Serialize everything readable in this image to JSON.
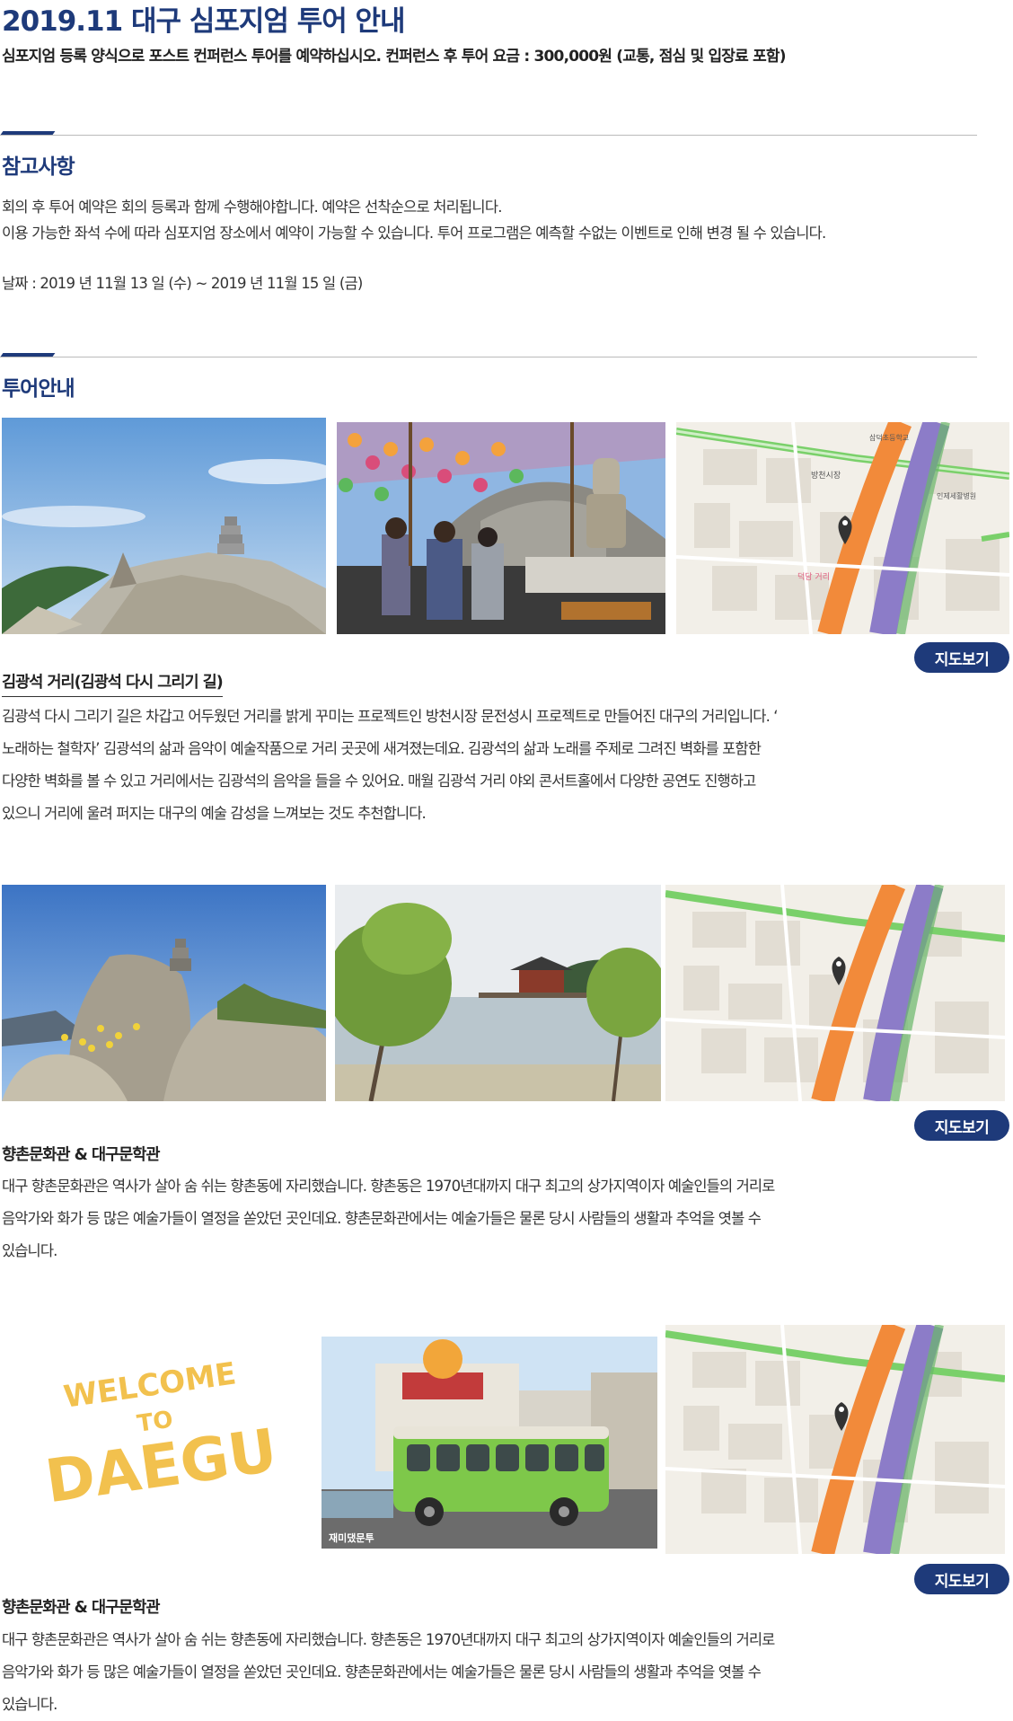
{
  "header": {
    "title": "2019.11 대구 심포지엄 투어 안내",
    "subtitle": "심포지엄 등록 양식으로 포스트 컨퍼런스 투어를 예약하십시오.  컨퍼런스 후 투어 요금 : 300,000원 (교통, 점심 및 입장료 포함)"
  },
  "notes": {
    "heading": "참고사항",
    "line1": "회의 후 투어 예약은 회의 등록과 함께 수행해야합니다. 예약은 선착순으로 처리됩니다.",
    "line2": "이용 가능한 좌석 수에 따라 심포지엄 장소에서 예약이 가능할 수 있습니다.  투어 프로그램은 예측할 수없는 이벤트로 인해 변경 될 수 있습니다.",
    "date": "날짜 : 2019 년 11월 13 일 (수) ~ 2019 년 11월 15 일 (금)"
  },
  "tour": {
    "heading": "투어안내",
    "items": [
      {
        "title": "김광석 거리(김광석 다시 그리기 길)",
        "map_button": "지도보기",
        "desc": [
          "김광석 다시 그리기 길은 차갑고 어두웠던 거리를 밝게 꾸미는 프로젝트인 방천시장 문전성시 프로젝트로 만들어진 대구의 거리입니다. ‘",
          "노래하는 철학자’ 김광석의 삶과 음악이 예술작품으로 거리 곳곳에 새겨졌는데요. 김광석의 삶과 노래를 주제로 그려진 벽화를 포함한",
          "다양한 벽화를 볼 수 있고 거리에서는 김광석의 음악을 들을 수 있어요. 매월 김광석 거리 야외 콘서트홀에서 다양한 공연도 진행하고",
          "있으니 거리에 울려 퍼지는 대구의 예술 감성을 느껴보는 것도 추천합니다."
        ]
      },
      {
        "title": "향촌문화관 & 대구문학관",
        "map_button": "지도보기",
        "desc": [
          "대구 향촌문화관은 역사가 살아 숨 쉬는 향촌동에 자리했습니다. 향촌동은 1970년대까지 대구 최고의 상가지역이자 예술인들의 거리로",
          "음악가와 화가 등 많은 예술가들이 열정을 쏟았던 곳인데요. 향촌문화관에서는 예술가들은 물론 당시 사람들의 생활과 추억을 엿볼 수",
          "있습니다."
        ]
      },
      {
        "title": "향촌문화관 & 대구문학관",
        "map_button": "지도보기",
        "desc": [
          "대구 향촌문화관은 역사가 살아 숨 쉬는 향촌동에 자리했습니다. 향촌동은 1970년대까지 대구 최고의 상가지역이자 예술인들의 거리로",
          "음악가와 화가 등 많은 예술가들이 열정을 쏟았던 곳인데요. 향촌문화관에서는 예술가들은 물론 당시 사람들의 생활과 추억을 엿볼 수",
          "있습니다."
        ]
      }
    ],
    "welcome": {
      "line1": "WELCOME",
      "line2": "TO",
      "line3": "DAEGU"
    },
    "map_labels": {
      "station": "방천시장",
      "street": "덕담 거리",
      "school": "삼덕초등학교",
      "hospital": "인제세활병원"
    },
    "bus_caption": "재미댔문투"
  },
  "colors": {
    "brand": "#1e3a7a",
    "welcome": "#f2c14e"
  }
}
